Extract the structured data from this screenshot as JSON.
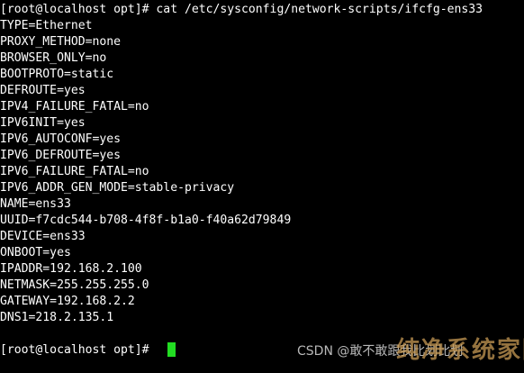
{
  "terminal": {
    "lines": [
      "[root@localhost opt]# cat /etc/sysconfig/network-scripts/ifcfg-ens33",
      "TYPE=Ethernet",
      "PROXY_METHOD=none",
      "BROWSER_ONLY=no",
      "BOOTPROTO=static",
      "DEFROUTE=yes",
      "IPV4_FAILURE_FATAL=no",
      "IPV6INIT=yes",
      "IPV6_AUTOCONF=yes",
      "IPV6_DEFROUTE=yes",
      "IPV6_FAILURE_FATAL=no",
      "IPV6_ADDR_GEN_MODE=stable-privacy",
      "NAME=ens33",
      "UUID=f7cdc544-b708-4f8f-b1a0-f40a62d79849",
      "DEVICE=ens33",
      "ONBOOT=yes",
      "IPADDR=192.168.2.100",
      "NETMASK=255.255.255.0",
      "GATEWAY=192.168.2.2",
      "DNS1=218.2.135.1",
      "",
      "[root@localhost opt]# "
    ],
    "background_color": "#000000",
    "text_color": "#ffffff",
    "cursor_color": "#22dd22"
  },
  "watermark": {
    "csdn": "CSDN @敢不敢跟我比划比划",
    "logo": "纯净系统家园"
  }
}
